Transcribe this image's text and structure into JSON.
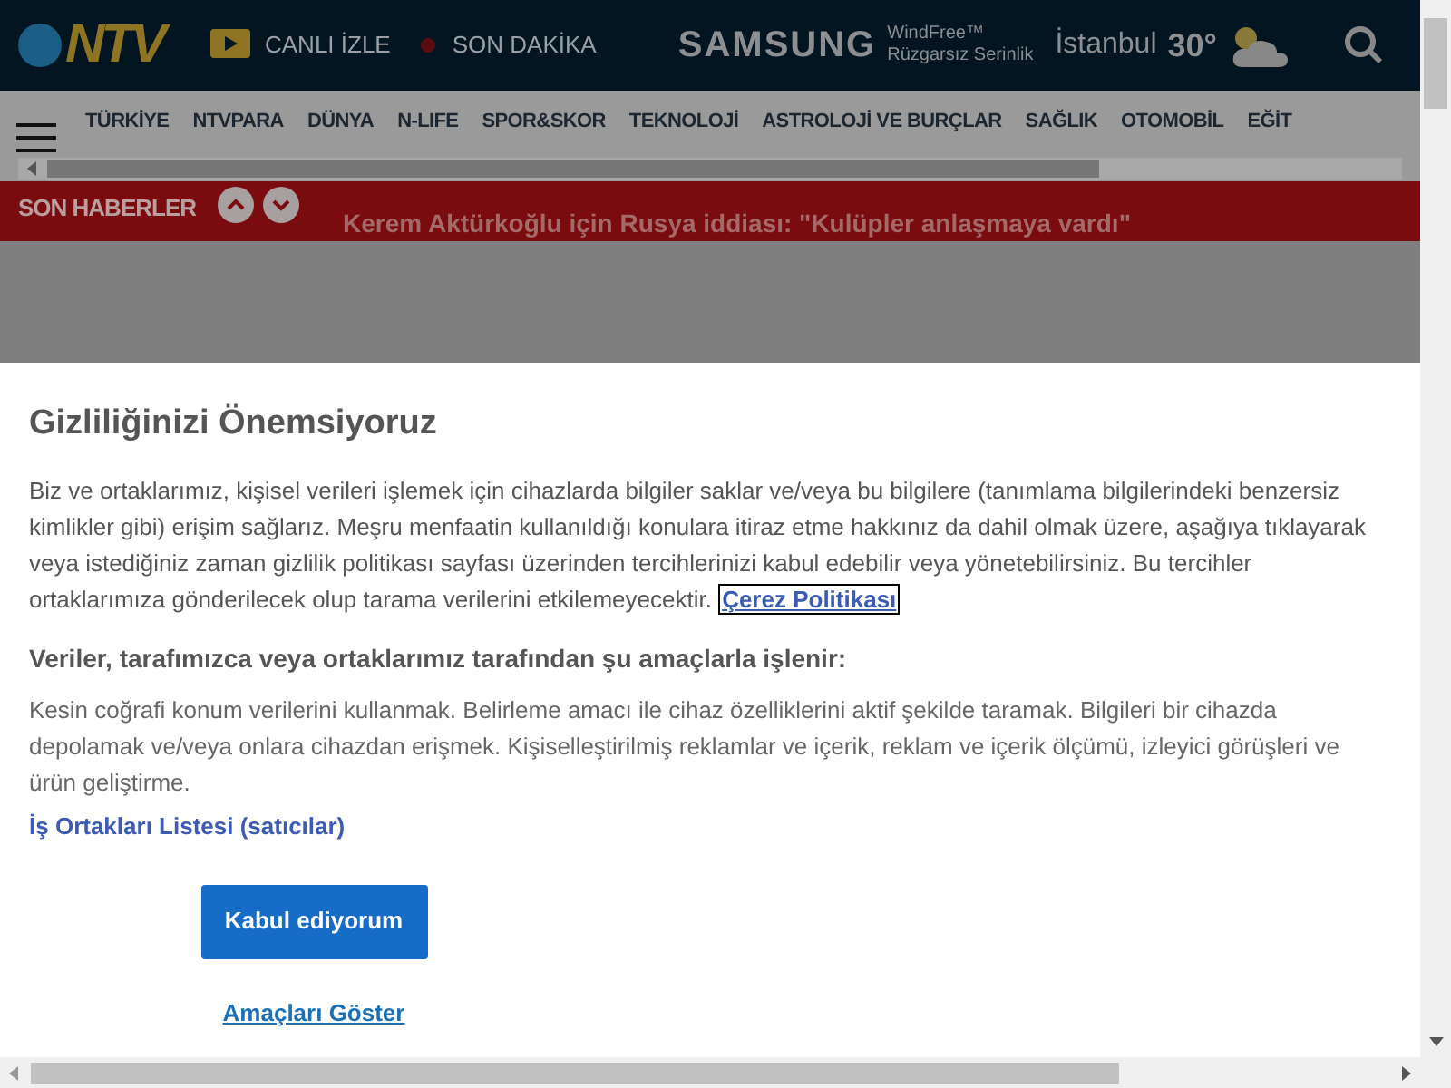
{
  "header": {
    "logo": "NTV",
    "live_label": "CANLI İZLE",
    "breaking_label": "SON DAKİKA",
    "sponsor": {
      "brand": "SAMSUNG",
      "tagline": "WindFree™",
      "subline": "Rüzgarsız Serinlik"
    },
    "city": "İstanbul",
    "temperature": "30°"
  },
  "nav": {
    "items": [
      "TÜRKİYE",
      "NTVPARA",
      "DÜNYA",
      "N-LIFE",
      "SPOR&SKOR",
      "TEKNOLOJİ",
      "ASTROLOJİ VE BURÇLAR",
      "SAĞLIK",
      "OTOMOBİL",
      "EĞİT"
    ]
  },
  "ticker": {
    "label": "SON HABERLER",
    "headline": "Kerem Aktürkoğlu için Rusya iddiası: \"Kulüpler anlaşmaya vardı\""
  },
  "consent": {
    "title": "Gizliliğinizi Önemsiyoruz",
    "intro": "Biz ve ortaklarımız, kişisel verileri işlemek için cihazlarda bilgiler saklar ve/veya bu bilgilere (tanımlama bilgilerindeki benzersiz kimlikler gibi) erişim sağlarız. Meşru menfaatin kullanıldığı konulara itiraz etme hakkınız da dahil olmak üzere, aşağıya tıklayarak veya istediğiniz zaman gizlilik politikası sayfası üzerinden tercihlerinizi kabul edebilir veya yönetebilirsiniz. Bu tercihler ortaklarımıza gönderilecek olup tarama verilerini etkilemeyecektir.",
    "policy_link": "Çerez Politikası",
    "purposes_title": "Veriler, tarafımızca veya ortaklarımız tarafından şu amaçlarla işlenir:",
    "purposes": "Kesin coğrafi konum verilerini kullanmak. Belirleme amacı ile cihaz özelliklerini aktif şekilde taramak. Bilgileri bir cihazda depolamak ve/veya onlara cihazdan erişmek. Kişiselleştirilmiş reklamlar ve içerik, reklam ve içerik ölçümü, izleyici görüşleri ve ürün geliştirme.",
    "partners_link": "İş Ortakları Listesi (satıcılar)",
    "accept_button": "Kabul ediyorum",
    "show_purposes_link": "Amaçları Göster"
  }
}
